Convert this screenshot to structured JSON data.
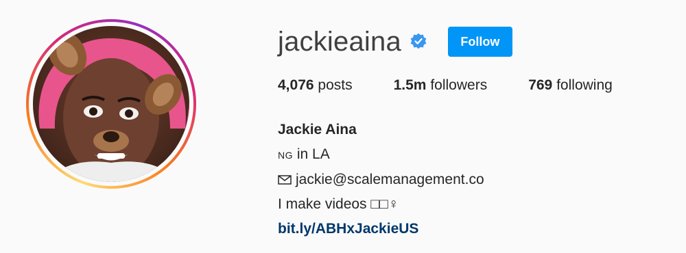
{
  "profile": {
    "username": "jackieaina",
    "follow_label": "Follow",
    "verified": true,
    "accent_color": "#0095f6",
    "icons": {
      "verified": "verified-badge-icon",
      "mail": "envelope-icon"
    }
  },
  "stats": {
    "posts_count": "4,076",
    "posts_label": "posts",
    "followers_count": "1.5m",
    "followers_label": "followers",
    "following_count": "769",
    "following_label": "following"
  },
  "bio": {
    "full_name": "Jackie Aina",
    "location_flag": "NG",
    "location_text": " in LA",
    "email": "jackie@scalemanagement.co",
    "tagline": "I make videos □□♀",
    "link": "bit.ly/ABHxJackieUS"
  }
}
